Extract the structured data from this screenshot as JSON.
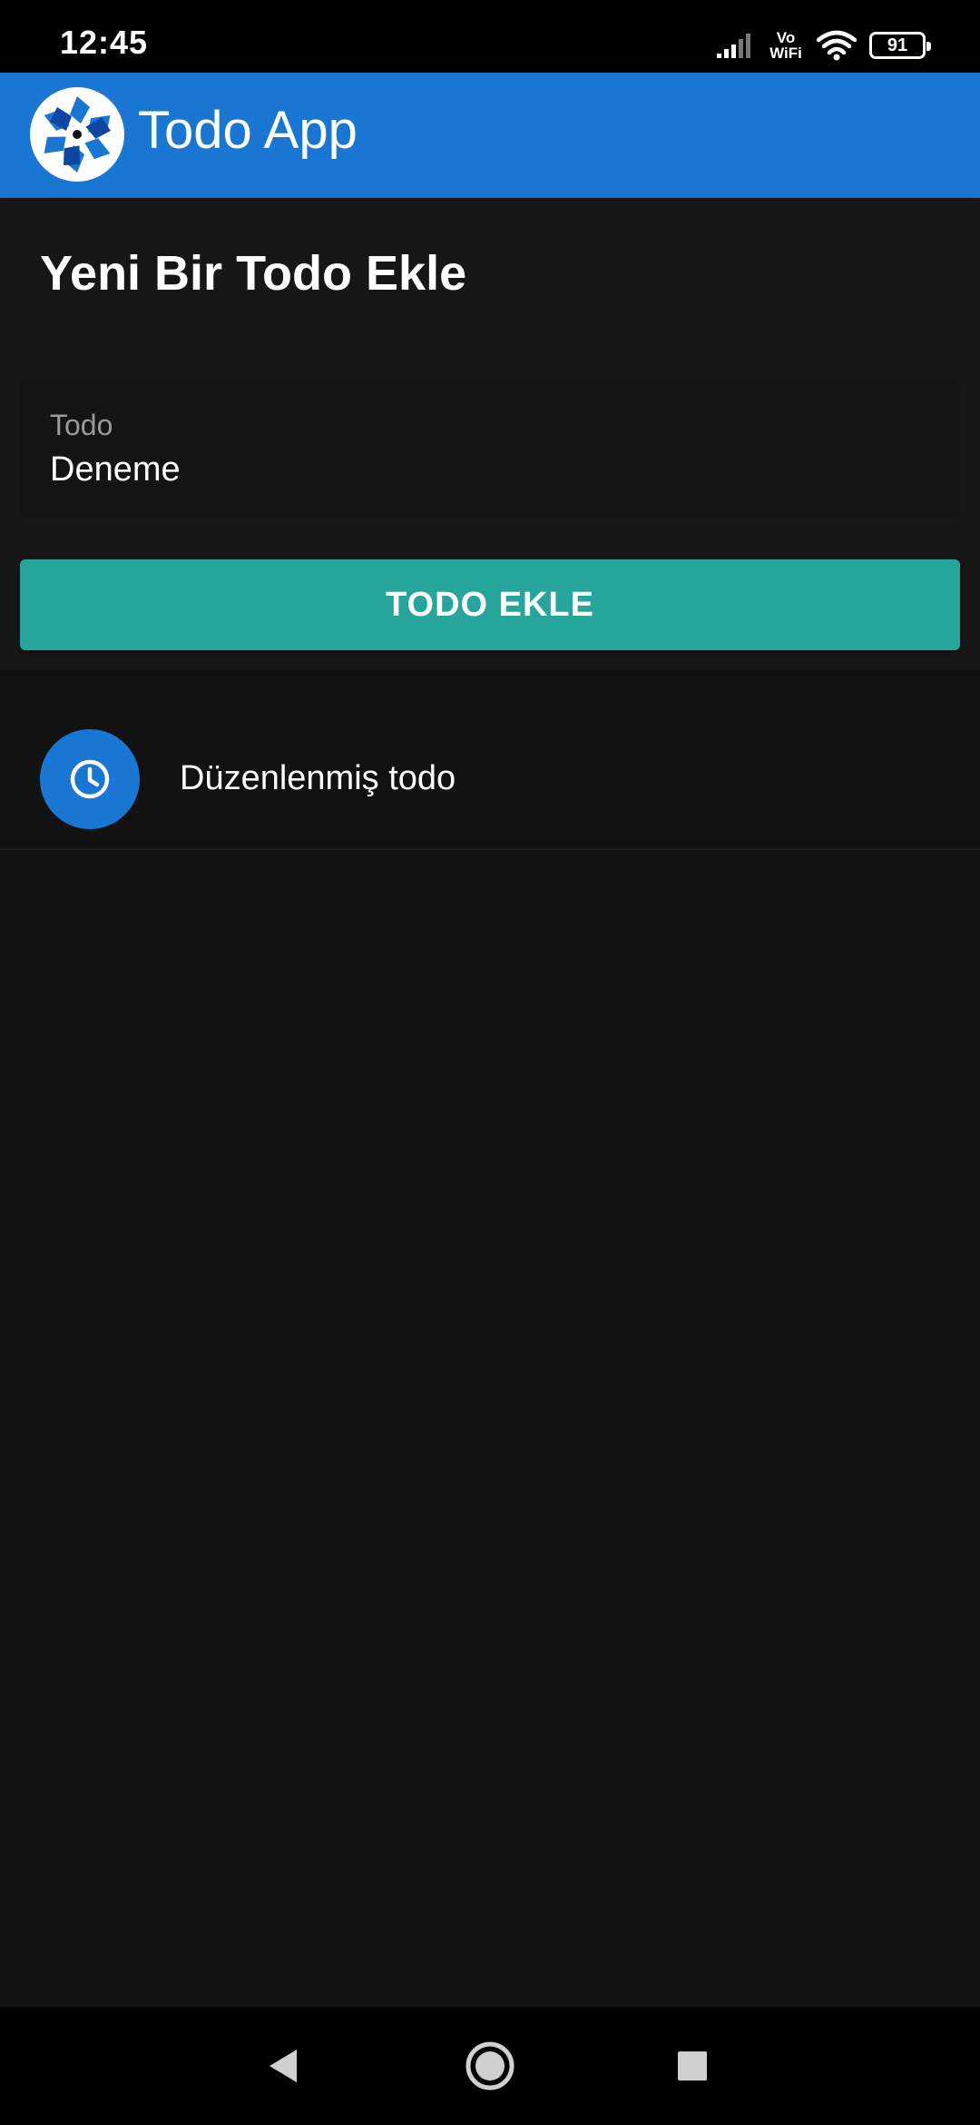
{
  "status_bar": {
    "time": "12:45",
    "network_label_top": "Vo",
    "network_label_bottom": "WiFi",
    "battery_level": "91",
    "icons": [
      "signal-icon",
      "vowifi-icon",
      "wifi-icon",
      "battery-icon"
    ]
  },
  "app_bar": {
    "title": "Todo App",
    "logo_icon": "app-logo-icon"
  },
  "add_form": {
    "heading": "Yeni Bir Todo Ekle",
    "field_label": "Todo",
    "field_value": "Deneme",
    "button_label": "TODO EKLE"
  },
  "todos": [
    {
      "text": "Düzenlenmiş todo",
      "icon": "clock-icon"
    }
  ],
  "nav_bar": {
    "icons": [
      "back-icon",
      "home-icon",
      "recents-icon"
    ]
  },
  "colors": {
    "primary": "#1976d2",
    "accent": "#26a69a",
    "background": "#121212"
  }
}
